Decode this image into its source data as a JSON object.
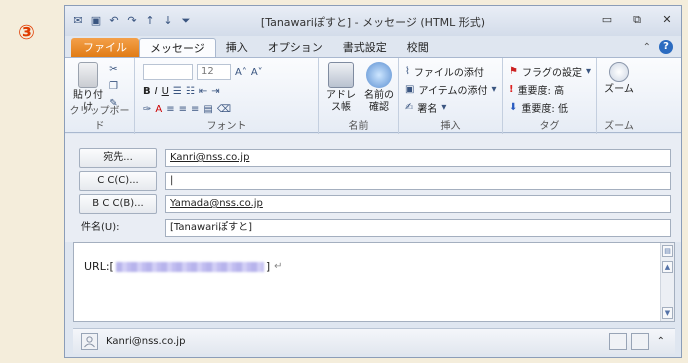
{
  "step_marker": "③",
  "window": {
    "title": "[Tanawariぽすと] - メッセージ (HTML 形式)",
    "controls": {
      "minimize": "▭",
      "restore": "⧉",
      "close": "✕"
    }
  },
  "tabs": [
    {
      "label": "ファイル"
    },
    {
      "label": "メッセージ"
    },
    {
      "label": "挿入"
    },
    {
      "label": "オプション"
    },
    {
      "label": "書式設定"
    },
    {
      "label": "校閲"
    }
  ],
  "ribbon": {
    "clipboard": {
      "paste": "貼り付け",
      "group": "クリップボード"
    },
    "font": {
      "size": "12",
      "group": "フォント"
    },
    "names": {
      "address_book": "アドレス帳",
      "check_names": "名前の確認",
      "group": "名前"
    },
    "insert": {
      "attach_file": "ファイルの添付",
      "attach_item": "アイテムの添付",
      "signature": "署名",
      "group": "挿入"
    },
    "tags": {
      "follow_up": "フラグの設定",
      "high": "重要度: 高",
      "low": "重要度: 低",
      "group": "タグ"
    },
    "zoom": {
      "zoom": "ズーム",
      "group": "ズーム"
    }
  },
  "addressing": {
    "to_label": "宛先...",
    "to_value": "Kanri@nss.co.jp",
    "cc_label": "C C(C)...",
    "cc_value": "|",
    "bcc_label": "B C C(B)...",
    "bcc_value": "Yamada@nss.co.jp",
    "subject_label": "件名(U):",
    "subject_value": "[Tanawariぽすと]"
  },
  "body": {
    "prefix": "URL:[",
    "suffix": "]"
  },
  "people_pane": {
    "name": "Kanri@nss.co.jp"
  }
}
